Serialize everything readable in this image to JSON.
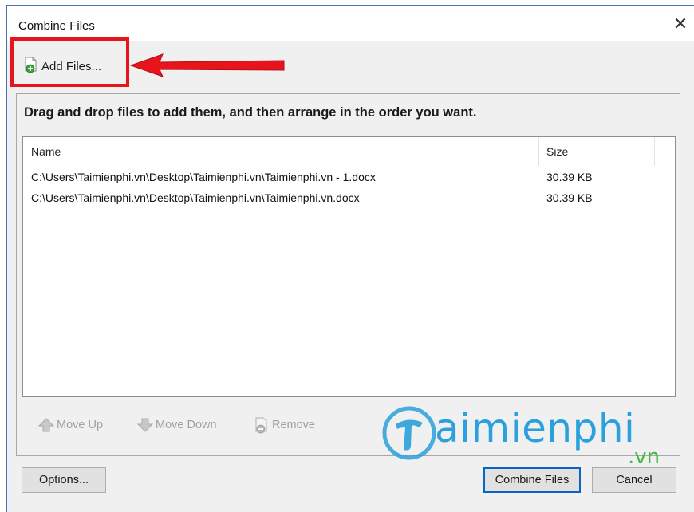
{
  "window": {
    "title": "Combine Files",
    "close_glyph": "✕"
  },
  "toolbar": {
    "add_files_label": "Add Files...",
    "add_files_icon": "add-file-icon"
  },
  "annotation": {
    "highlight_color": "#e8141b"
  },
  "panel": {
    "instructions": "Drag and drop files to add them, and then arrange in the order you want."
  },
  "file_list": {
    "columns": [
      "Name",
      "Size"
    ],
    "rows": [
      {
        "name": "C:\\Users\\Taimienphi.vn\\Desktop\\Taimienphi.vn\\Taimienphi.vn - 1.docx",
        "size": "30.39 KB"
      },
      {
        "name": "C:\\Users\\Taimienphi.vn\\Desktop\\Taimienphi.vn\\Taimienphi.vn.docx",
        "size": "30.39 KB"
      }
    ]
  },
  "actions": {
    "move_up": "Move Up",
    "move_down": "Move Down",
    "remove": "Remove"
  },
  "watermark": {
    "brand": "aimienphi",
    "tld": ".vn",
    "brand_color": "#2aa0dc",
    "tld_color": "#48b848"
  },
  "footer": {
    "options_label": "Options...",
    "combine_label": "Combine Files",
    "cancel_label": "Cancel"
  }
}
